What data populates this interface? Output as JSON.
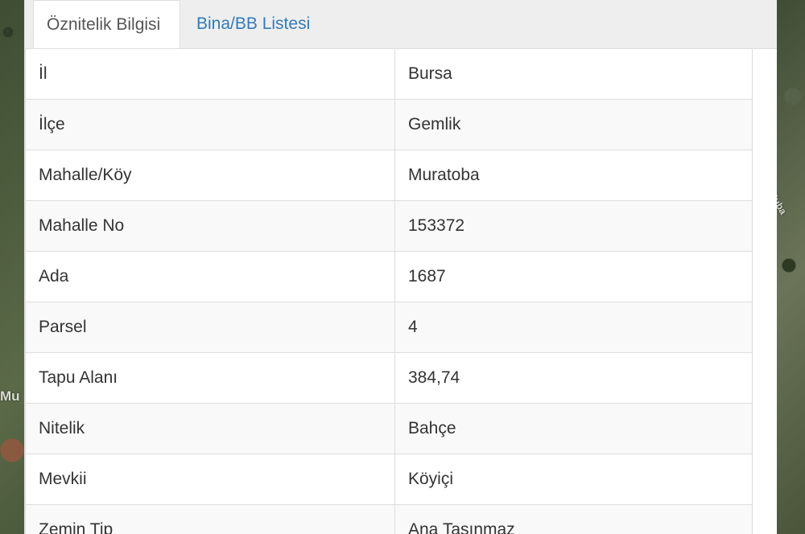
{
  "map": {
    "label_left": "Mu",
    "label_right": "Ruba So"
  },
  "tabs": [
    {
      "label": "Öznitelik Bilgisi",
      "active": true
    },
    {
      "label": "Bina/BB Listesi",
      "active": false
    }
  ],
  "rows": [
    {
      "key": "İl",
      "value": "Bursa"
    },
    {
      "key": "İlçe",
      "value": "Gemlik"
    },
    {
      "key": "Mahalle/Köy",
      "value": "Muratoba"
    },
    {
      "key": "Mahalle No",
      "value": "153372"
    },
    {
      "key": "Ada",
      "value": "1687"
    },
    {
      "key": "Parsel",
      "value": "4"
    },
    {
      "key": "Tapu Alanı",
      "value": "384,74"
    },
    {
      "key": "Nitelik",
      "value": "Bahçe"
    },
    {
      "key": "Mevkii",
      "value": "Köyiçi"
    },
    {
      "key": "Zemin Tip",
      "value": "Ana Taşınmaz"
    }
  ],
  "colors": {
    "link": "#337ab7",
    "text": "#333333",
    "border": "#dddddd",
    "stripe": "#f9f9f9"
  }
}
